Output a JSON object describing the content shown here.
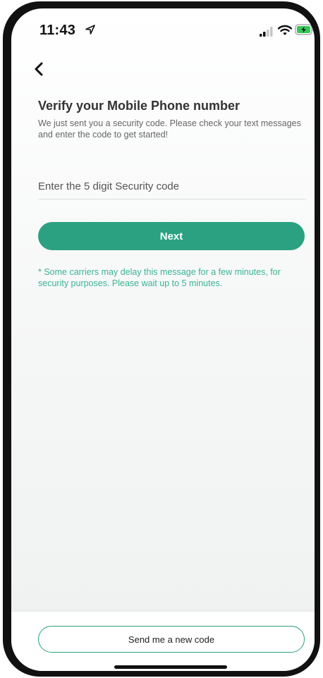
{
  "status_bar": {
    "time": "11:43",
    "icons": [
      "location-arrow-icon",
      "signal-icon",
      "wifi-icon",
      "battery-charging-icon"
    ]
  },
  "nav": {
    "back_icon": "chevron-left-icon"
  },
  "verify": {
    "title": "Verify your Mobile Phone number",
    "subtitle": "We just sent you a security code. Please check your text messages and enter the code to get started!",
    "code_placeholder": "Enter the 5 digit Security code",
    "code_value": "",
    "next_label": "Next",
    "carrier_note": "* Some carriers may delay this message for a few minutes, for security purposes. Please wait up to 5 minutes."
  },
  "footer": {
    "resend_label": "Send me a new code"
  },
  "colors": {
    "accent": "#2ba181",
    "note_text": "#3bb394",
    "battery_fill": "#34c759"
  }
}
